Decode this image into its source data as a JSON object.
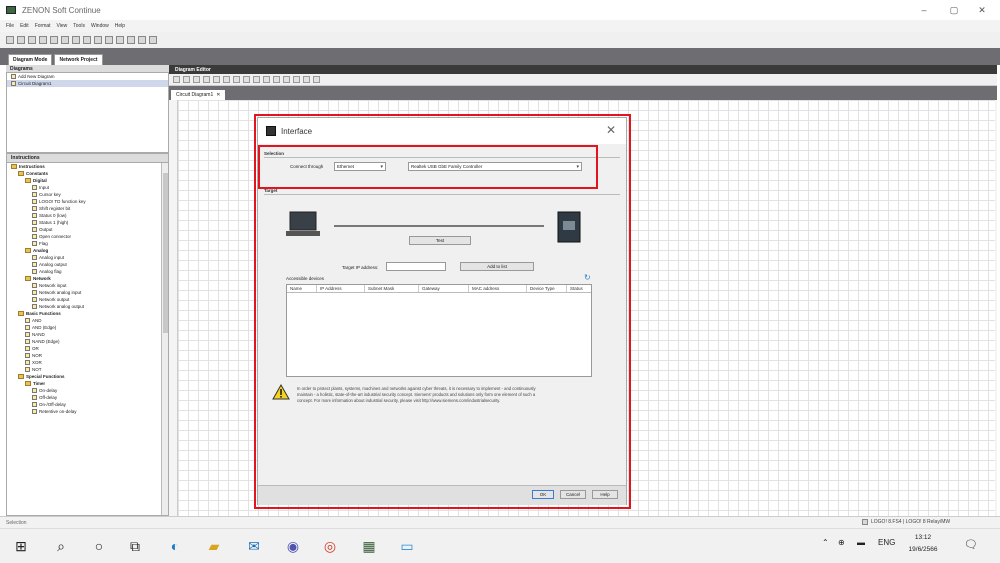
{
  "app": {
    "title": "ZENON Soft Continue"
  },
  "menu": [
    "File",
    "Edit",
    "Format",
    "View",
    "Tools",
    "Window",
    "Help"
  ],
  "tabs": {
    "diagram": "Diagram Mode",
    "network": "Network Project"
  },
  "left": {
    "diagrams_header": "Diagrams",
    "diagram_items": [
      "Add New Diagram",
      "Circuit Diagram1"
    ],
    "instructions_header": "Instructions",
    "tree": [
      {
        "t": "Instructions",
        "l": 0,
        "k": "fold"
      },
      {
        "t": "Constants",
        "l": 1,
        "k": "fold"
      },
      {
        "t": "Digital",
        "l": 2,
        "k": "fold"
      },
      {
        "t": "Input",
        "l": 3,
        "k": "sq"
      },
      {
        "t": "Cursor key",
        "l": 3,
        "k": "sq"
      },
      {
        "t": "LOGO! TD function key",
        "l": 3,
        "k": "sq"
      },
      {
        "t": "Shift register bit",
        "l": 3,
        "k": "sq"
      },
      {
        "t": "Status 0 (low)",
        "l": 3,
        "k": "sq"
      },
      {
        "t": "Status 1 (high)",
        "l": 3,
        "k": "sq"
      },
      {
        "t": "Output",
        "l": 3,
        "k": "sq"
      },
      {
        "t": "Open connector",
        "l": 3,
        "k": "sq"
      },
      {
        "t": "Flag",
        "l": 3,
        "k": "sq"
      },
      {
        "t": "Analog",
        "l": 2,
        "k": "fold"
      },
      {
        "t": "Analog input",
        "l": 3,
        "k": "sq"
      },
      {
        "t": "Analog output",
        "l": 3,
        "k": "sq"
      },
      {
        "t": "Analog flag",
        "l": 3,
        "k": "sq"
      },
      {
        "t": "Network",
        "l": 2,
        "k": "fold"
      },
      {
        "t": "Network input",
        "l": 3,
        "k": "sq"
      },
      {
        "t": "Network analog input",
        "l": 3,
        "k": "sq"
      },
      {
        "t": "Network output",
        "l": 3,
        "k": "sq"
      },
      {
        "t": "Network analog output",
        "l": 3,
        "k": "sq"
      },
      {
        "t": "Basic Functions",
        "l": 1,
        "k": "fold"
      },
      {
        "t": "AND",
        "l": 2,
        "k": "sq"
      },
      {
        "t": "AND (Edge)",
        "l": 2,
        "k": "sq"
      },
      {
        "t": "NAND",
        "l": 2,
        "k": "sq"
      },
      {
        "t": "NAND (Edge)",
        "l": 2,
        "k": "sq"
      },
      {
        "t": "OR",
        "l": 2,
        "k": "sq"
      },
      {
        "t": "NOR",
        "l": 2,
        "k": "sq"
      },
      {
        "t": "XOR",
        "l": 2,
        "k": "sq"
      },
      {
        "t": "NOT",
        "l": 2,
        "k": "sq"
      },
      {
        "t": "Special Functions",
        "l": 1,
        "k": "fold"
      },
      {
        "t": "Timer",
        "l": 2,
        "k": "fold"
      },
      {
        "t": "On-delay",
        "l": 3,
        "k": "sq"
      },
      {
        "t": "Off-delay",
        "l": 3,
        "k": "sq"
      },
      {
        "t": "On-/Off-delay",
        "l": 3,
        "k": "sq"
      },
      {
        "t": "Retentive on-delay",
        "l": 3,
        "k": "sq"
      }
    ]
  },
  "editor": {
    "header": "Diagram Editor",
    "tab": "Circuit Diagram1"
  },
  "dialog": {
    "title": "Interface",
    "selection_label": "Selection",
    "connect_label": "Connect through",
    "connect_value": "Ethernet",
    "adapter_value": "Realtek USB GbE Family Controller",
    "target_label": "Target",
    "link_button": "Test",
    "target_address_label": "Target IP address:",
    "target_address_value": "",
    "detect_button": "Add to list",
    "accessible_label": "Accessible devices",
    "columns": [
      "Name",
      "IP Address",
      "Subnet Mask",
      "Gateway",
      "MAC address",
      "Device Type",
      "Status"
    ],
    "warning": "In order to protect plants, systems, machines and networks against cyber threats, it is necessary to implement - and continuously maintain - a holistic, state-of-the-art industrial security concept. Siemens' products and solutions only form one element of such a concept. For more information about industrial security, please visit http://www.siemens.com/industrialsecurity.",
    "ok": "OK",
    "cancel": "Cancel",
    "help": "Help"
  },
  "status": {
    "left": "Selection",
    "right": "LOGO! 8.FS4 | LOGO! 8 Relay/MW"
  },
  "taskbar": {
    "lang": "ENG",
    "time": "13:12",
    "date": "19/6/2566"
  },
  "colors": {
    "highlight": "#e2141e",
    "panel_header": "#3a3a3a",
    "tab_strip": "#6e6e72"
  }
}
